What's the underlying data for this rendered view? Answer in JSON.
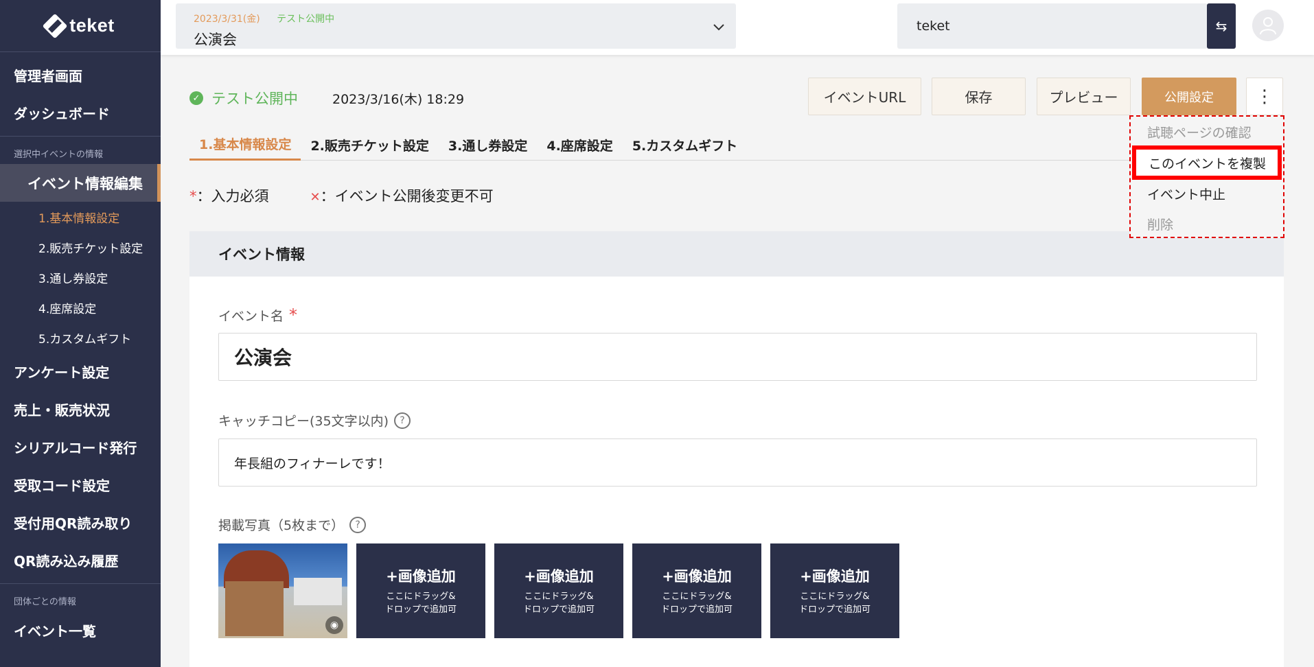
{
  "sidebar": {
    "logo_text": "teket",
    "top_items": [
      "管理者画面",
      "ダッシュボード"
    ],
    "section_selected": "選択中イベントの情報",
    "active_item": "イベント情報編集",
    "sub_items": [
      "1.基本情報設定",
      "2.販売チケット設定",
      "3.通し券設定",
      "4.座席設定",
      "5.カスタムギフト"
    ],
    "main_items": [
      "アンケート設定",
      "売上・販売状況",
      "シリアルコード発行",
      "受取コード設定",
      "受付用QR読み取り",
      "QR読み込み履歴"
    ],
    "section_org": "団体ごとの情報",
    "org_items": [
      "イベント一覧"
    ]
  },
  "header": {
    "event_date": "2023/3/31(金)",
    "event_state": "テスト公開中",
    "event_name": "公演会",
    "org_name": "teket"
  },
  "status": {
    "label": "テスト公開中",
    "datetime": "2023/3/16(木) 18:29"
  },
  "toolbar": {
    "url_label": "イベントURL",
    "save_label": "保存",
    "preview_label": "プレビュー",
    "publish_label": "公開設定",
    "more_label": "⋮"
  },
  "tabs": [
    "1.基本情報設定",
    "2.販売チケット設定",
    "3.通し券設定",
    "4.座席設定",
    "5.カスタムギフト"
  ],
  "legend": {
    "required_mark": "*",
    "required_text": "：入力必須",
    "nochange_mark": "✕",
    "nochange_text": "：イベント公開後変更不可"
  },
  "dropdown": [
    "試聴ページの確認",
    "このイベントを複製",
    "イベント中止",
    "削除"
  ],
  "card": {
    "title": "イベント情報",
    "name_label": "イベント名",
    "name_value": "公演会",
    "catch_label": "キャッチコピー(35文字以内)",
    "catch_value": "年長組のフィナーレです！",
    "photos_label": "掲載写真（5枚まで）",
    "add_image_label": "+画像追加",
    "add_image_hint1": "ここにドラッグ&",
    "add_image_hint2": "ドロップで追加可"
  }
}
